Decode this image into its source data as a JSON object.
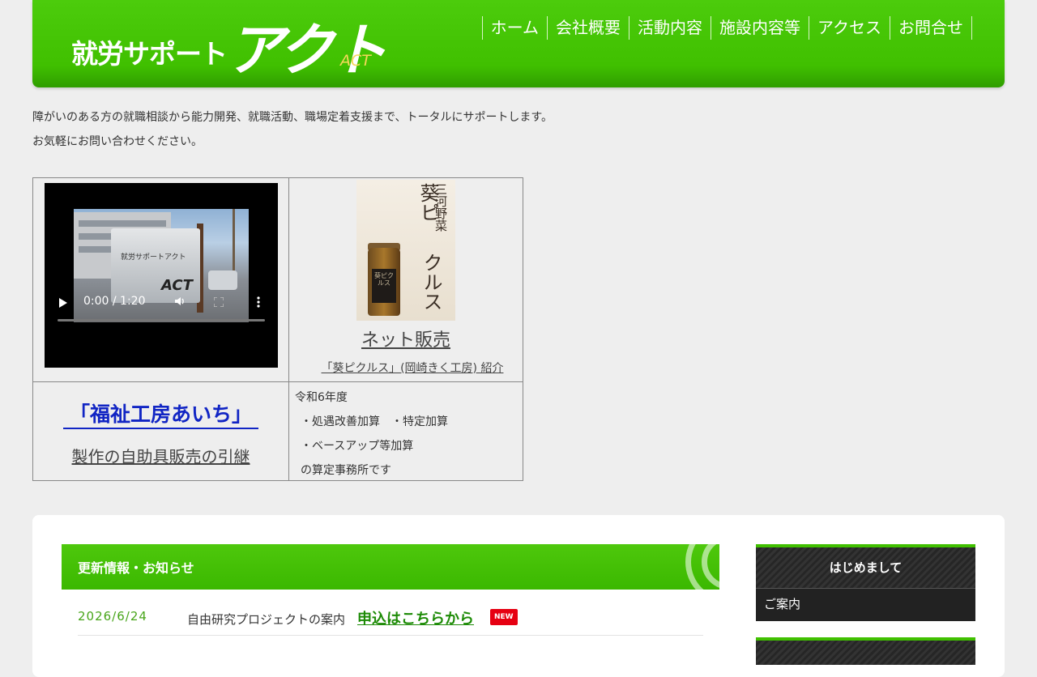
{
  "header": {
    "logo_main": "就労サポート",
    "logo_big": "アクト",
    "logo_sub": "ACT",
    "nav": [
      "ホーム",
      "会社概要",
      "活動内容",
      "施設内容等",
      "アクセス",
      "お問合せ"
    ]
  },
  "intro": {
    "line1": "障がいのある方の就職相談から能力開発、就職活動、職場定着支援まで、トータルにサポートします。",
    "line2": "お気軽にお問い合わせください。"
  },
  "video": {
    "time": "0:00 / 1:20",
    "progress": 0,
    "sign_text": "就労サポートアクト",
    "sign_logo": "ACT"
  },
  "pickles": {
    "jar_vertical_1": "三河野菜",
    "jar_vertical_2": "葵ピ",
    "jar_vertical_3": "クルス",
    "jar_label": "葵ピクルス",
    "net_label": "ネット販売",
    "link_label": "「葵ピクルス」(岡崎きく工房) 紹介"
  },
  "fukushi": {
    "title": "「福祉工房あいち」",
    "sub": "製作の自助具販売の引継"
  },
  "reiwa": {
    "lines": [
      "令和6年度",
      "・処遇改善加算　・特定加算",
      "・ベースアップ等加算",
      "の算定事務所です"
    ]
  },
  "news": {
    "title": "更新情報・お知らせ",
    "items": [
      {
        "date": "2026/6/24",
        "text": "自由研究プロジェクトの案内",
        "link": "申込はこちらから",
        "badge": "NEW"
      }
    ]
  },
  "sidebar": {
    "heading": "はじめまして",
    "items": [
      "ご案内"
    ]
  },
  "colors": {
    "brand_green": "#40c000",
    "news_date": "#48a51a",
    "link_blue": "#1125c4",
    "badge_red": "#e60012"
  }
}
